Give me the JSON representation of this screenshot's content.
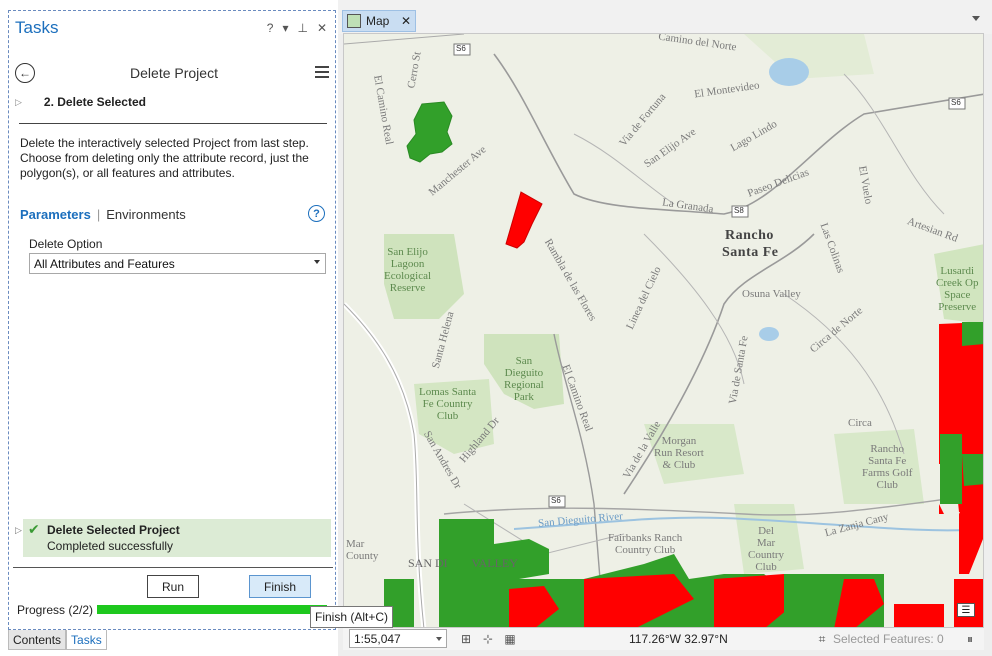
{
  "tasks_pane": {
    "title": "Tasks",
    "controls": {
      "help": "?",
      "dropdown": "▾",
      "pin": "ㅍ",
      "close": "✕"
    },
    "task_name": "Delete Project",
    "step": {
      "number_label": "2.  Delete Selected"
    },
    "description": "Delete the interactively selected Project from last step. Choose from deleting only the attribute record, just the polygon(s), or all features and attributes.",
    "tabs": {
      "parameters": "Parameters",
      "separator": "|",
      "environments": "Environments"
    },
    "help_glyph": "?",
    "delete_option": {
      "label": "Delete Option",
      "value": "All Attributes and Features"
    },
    "message": {
      "title": "Delete Selected Project",
      "subtitle": "Completed successfully"
    },
    "buttons": {
      "run": "Run",
      "finish": "Finish"
    },
    "progress": {
      "label": "Progress (2/2)",
      "fraction": 1.0
    },
    "bottom_tabs": {
      "contents": "Contents",
      "tasks": "Tasks"
    }
  },
  "tooltip": "Finish (Alt+C)",
  "map": {
    "tab_label": "Map",
    "labels": {
      "rancho": "Rancho",
      "santa_fe": "Santa Fe",
      "san_elijo": "San Elijo\nLagoon\nEcological\nReserve",
      "san_dieguito": "San\nDieguito\nRegional\nPark",
      "lomas": "Lomas Santa\nFe Country\nClub",
      "morgan": "Morgan\nRun Resort\n& Club",
      "rancho_farms": "Rancho\nSanta Fe\nFarms Golf\nClub",
      "del_mar_cc": "Del\nMar\nCountry\nClub",
      "fairbanks": "Fairbanks Ranch\nCountry Club",
      "osuna": "Osuna Valley",
      "la_granada": "La Granada",
      "paseo": "Paseo Delicias",
      "manchester": "Manchester Ave",
      "el_camino_real": "El Camino Real",
      "via_de_la_valle": "Via de la Valle",
      "san_dieguito_river": "San Dieguito River",
      "la_zanja": "La Zanja Cany",
      "lusardi": "Lusardi\nCreek Op\nSpace\nPreserve",
      "mar_county": "Mar\nCounty",
      "san_di_valley": "SAN DI        VALLEY",
      "lago_lindo": "Lago Lindo",
      "san_elijo_ave": "San Elijo Ave",
      "el_montevideo": "El Montevideo",
      "circa_del_norte": "Circa de Norte",
      "linea_del_cielo": "Linea del Cielo",
      "rambla": "Rambla de las Flores",
      "via_de_santa_fe": "Via de Santa Fe",
      "el_vuelo": "El Vuelo",
      "las_colinas": "Las Colinas",
      "arteisian": "Artesian Rd",
      "santa_helena": "Santa Helena",
      "highland": "Highland Dr",
      "san_andres": "San Andres Dr",
      "via_de_fortuna": "Via de Fortuna",
      "camino_del_norte": "Camino del Norte",
      "circa": "Circa",
      "el_camino_real_2": "El Camino Real",
      "cerro": "Cerro St",
      "s6": "S6",
      "s8": "S8"
    },
    "status": {
      "scale": "1:55,047",
      "coordinates": "117.26°W 32.97°N",
      "selected_features": "Selected Features: 0"
    }
  }
}
